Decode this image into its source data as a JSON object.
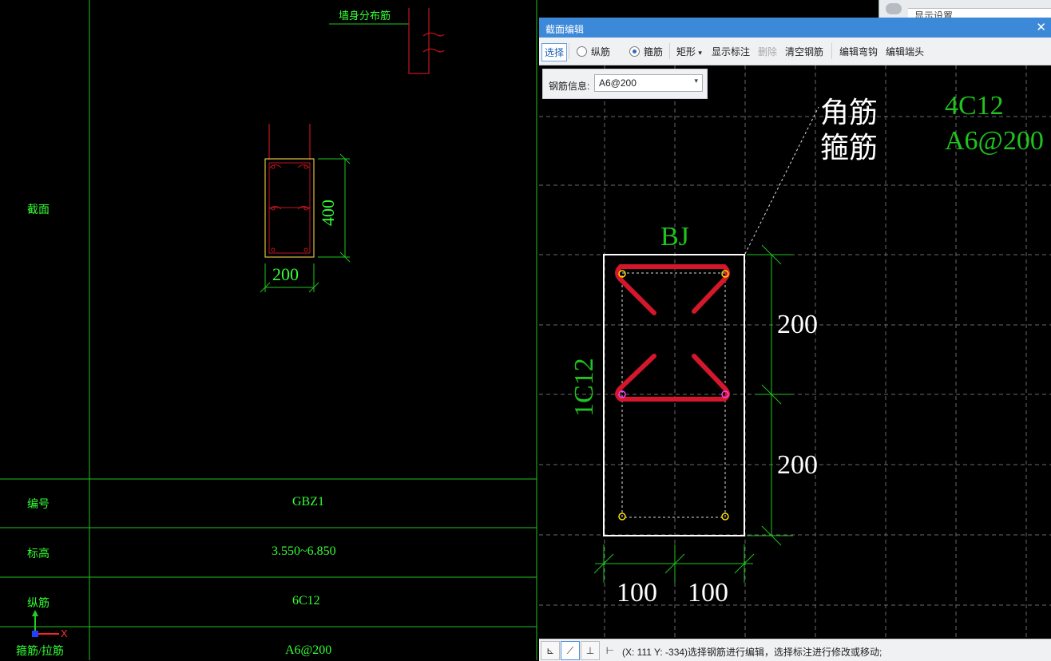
{
  "left_drawing": {
    "wall_dist_label": "墙身分布筋",
    "section_label": "截面",
    "dim_height": "400",
    "dim_width": "200",
    "table": {
      "rows": [
        {
          "label": "编号",
          "value": "GBZ1"
        },
        {
          "label": "标高",
          "value": "3.550~6.850"
        },
        {
          "label": "纵筋",
          "value": "6C12"
        },
        {
          "label": "箍筋/拉筋",
          "value": "A6@200"
        }
      ]
    },
    "axis_x": "X",
    "colors": {
      "line": "#1fc31f",
      "text": "#33ff33",
      "rebar": "#c0151d",
      "outline": "#e0c040"
    }
  },
  "display_panel": {
    "title": "显示设置"
  },
  "dialog": {
    "title": "截面编辑",
    "close_icon": "close-icon",
    "toolbar": {
      "select": "选择",
      "longitudinal": "纵筋",
      "stirrup": "箍筋",
      "shape": "矩形",
      "shape_arrow": "▾",
      "show_annotation": "显示标注",
      "delete": "删除",
      "clear_rebar": "清空钢筋",
      "edit_hook": "编辑弯钩",
      "edit_end": "编辑端头"
    },
    "rebar_info": {
      "label": "钢筋信息:",
      "value": "A6@200",
      "arrow": "▾"
    },
    "canvas": {
      "corner_bar_label": "角筋",
      "corner_bar_value": "4C12",
      "stirrup_label": "箍筋",
      "stirrup_value": "A6@200",
      "section_name": "BJ",
      "side_bar": "1C12",
      "dim_upper": "200",
      "dim_lower": "200",
      "dim_left": "100",
      "dim_right": "100"
    },
    "statusbar": {
      "text": "(X: 111 Y: -334)选择钢筋进行编辑，选择标注进行修改或移动;"
    },
    "colors": {
      "title_bar": "#3c88d9",
      "grid": "#6a6a6a",
      "rebar": "#d4172a",
      "dim": "#1fc31f",
      "outline": "#ffffff"
    }
  }
}
